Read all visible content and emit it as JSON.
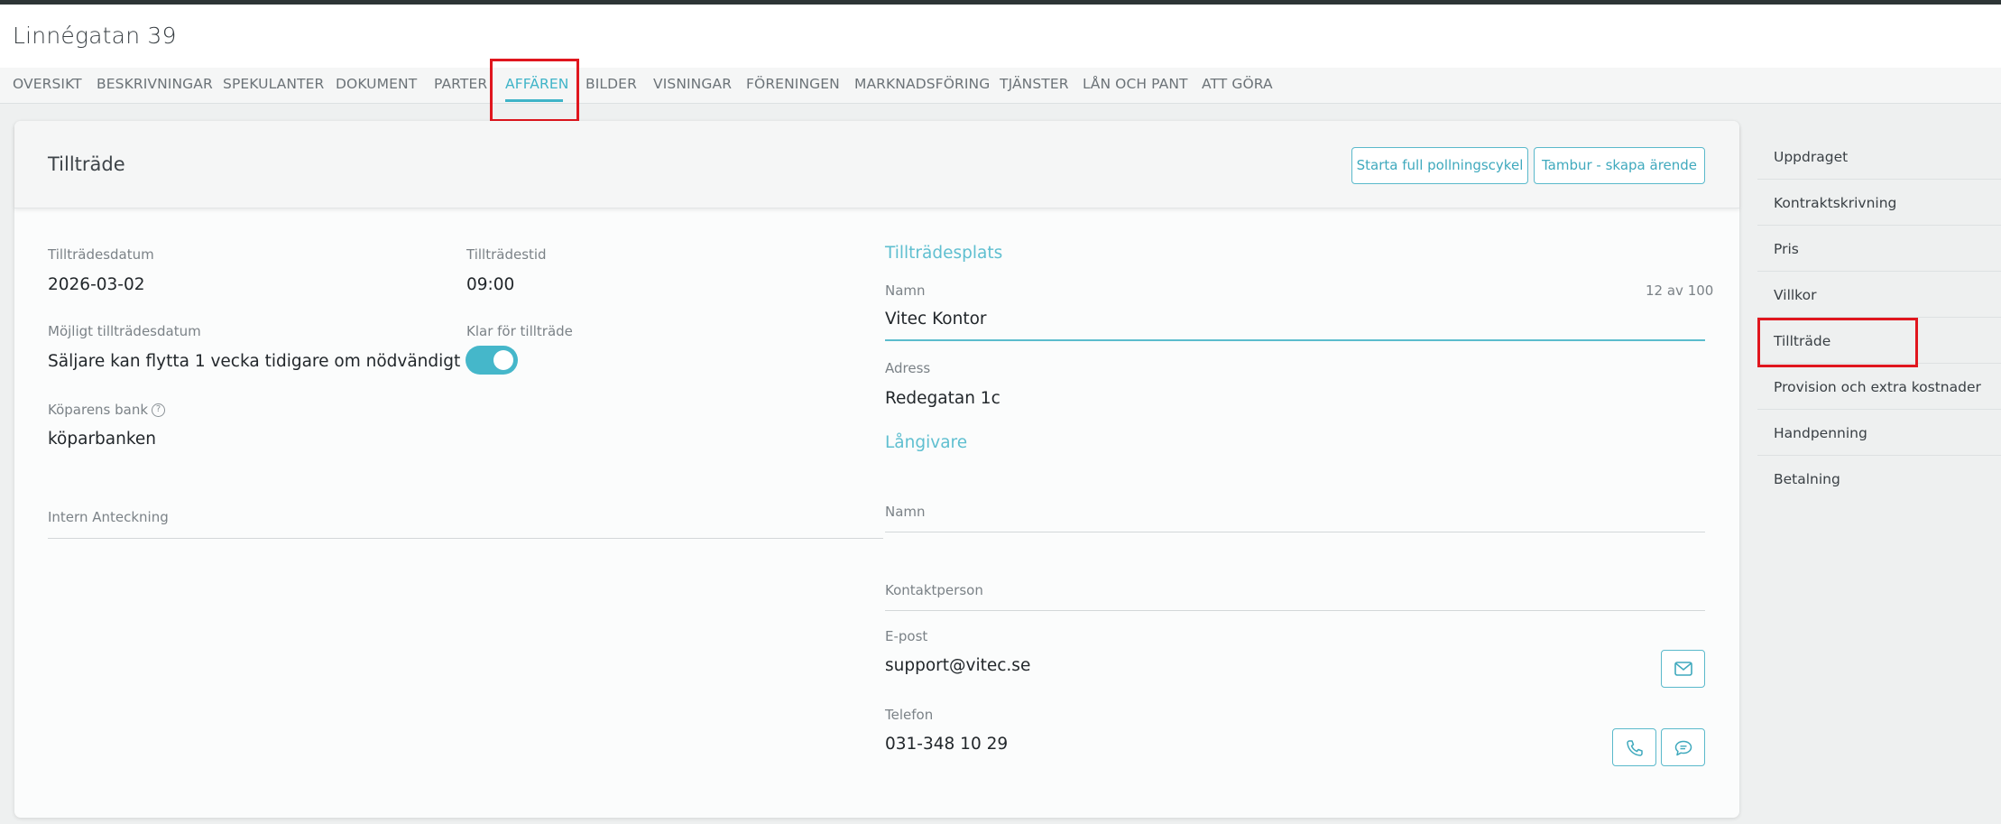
{
  "page": {
    "title": "Linnégatan 39"
  },
  "tabs": [
    "OVERSIKT",
    "BESKRIVNINGAR",
    "SPEKULANTER",
    "DOKUMENT",
    "PARTER",
    "AFFÄREN",
    "BILDER",
    "VISNINGAR",
    "FÖRENINGEN",
    "MARKNADSFÖRING",
    "TJÄNSTER",
    "LÅN OCH PANT",
    "ATT GÖRA"
  ],
  "active_tab": "AFFÄREN",
  "card": {
    "title": "Tillträde",
    "buttons": {
      "polling": "Starta full pollningscykel",
      "tambur": "Tambur - skapa ärende"
    }
  },
  "left": {
    "date_label": "Tillträdesdatum",
    "date_value": "2026-03-02",
    "time_label": "Tillträdestid",
    "time_value": "09:00",
    "possible_label": "Möjligt tillträdesdatum",
    "possible_value": "Säljare kan flytta 1 vecka tidigare om nödvändigt",
    "ready_label": "Klar för tillträde",
    "ready": true,
    "bank_label": "Köparens bank",
    "bank_value": "köparbanken",
    "note_label": "Intern Anteckning"
  },
  "place": {
    "section": "Tillträdesplats",
    "name_label": "Namn",
    "name_value": "Vitec Kontor",
    "name_counter": "12 av 100",
    "address_label": "Adress",
    "address_value": "Redegatan 1c"
  },
  "lender": {
    "section": "Långivare",
    "name_label": "Namn",
    "contact_label": "Kontaktperson",
    "email_label": "E-post",
    "email_value": "support@vitec.se",
    "phone_label": "Telefon",
    "phone_value": "031-348 10 29"
  },
  "sidebar": [
    "Uppdraget",
    "Kontraktskrivning",
    "Pris",
    "Villkor",
    "Tillträde",
    "Provision och extra kostnader",
    "Handpenning",
    "Betalning"
  ],
  "colors": {
    "accent": "#3fb4c8",
    "highlight": "#e0161e"
  }
}
